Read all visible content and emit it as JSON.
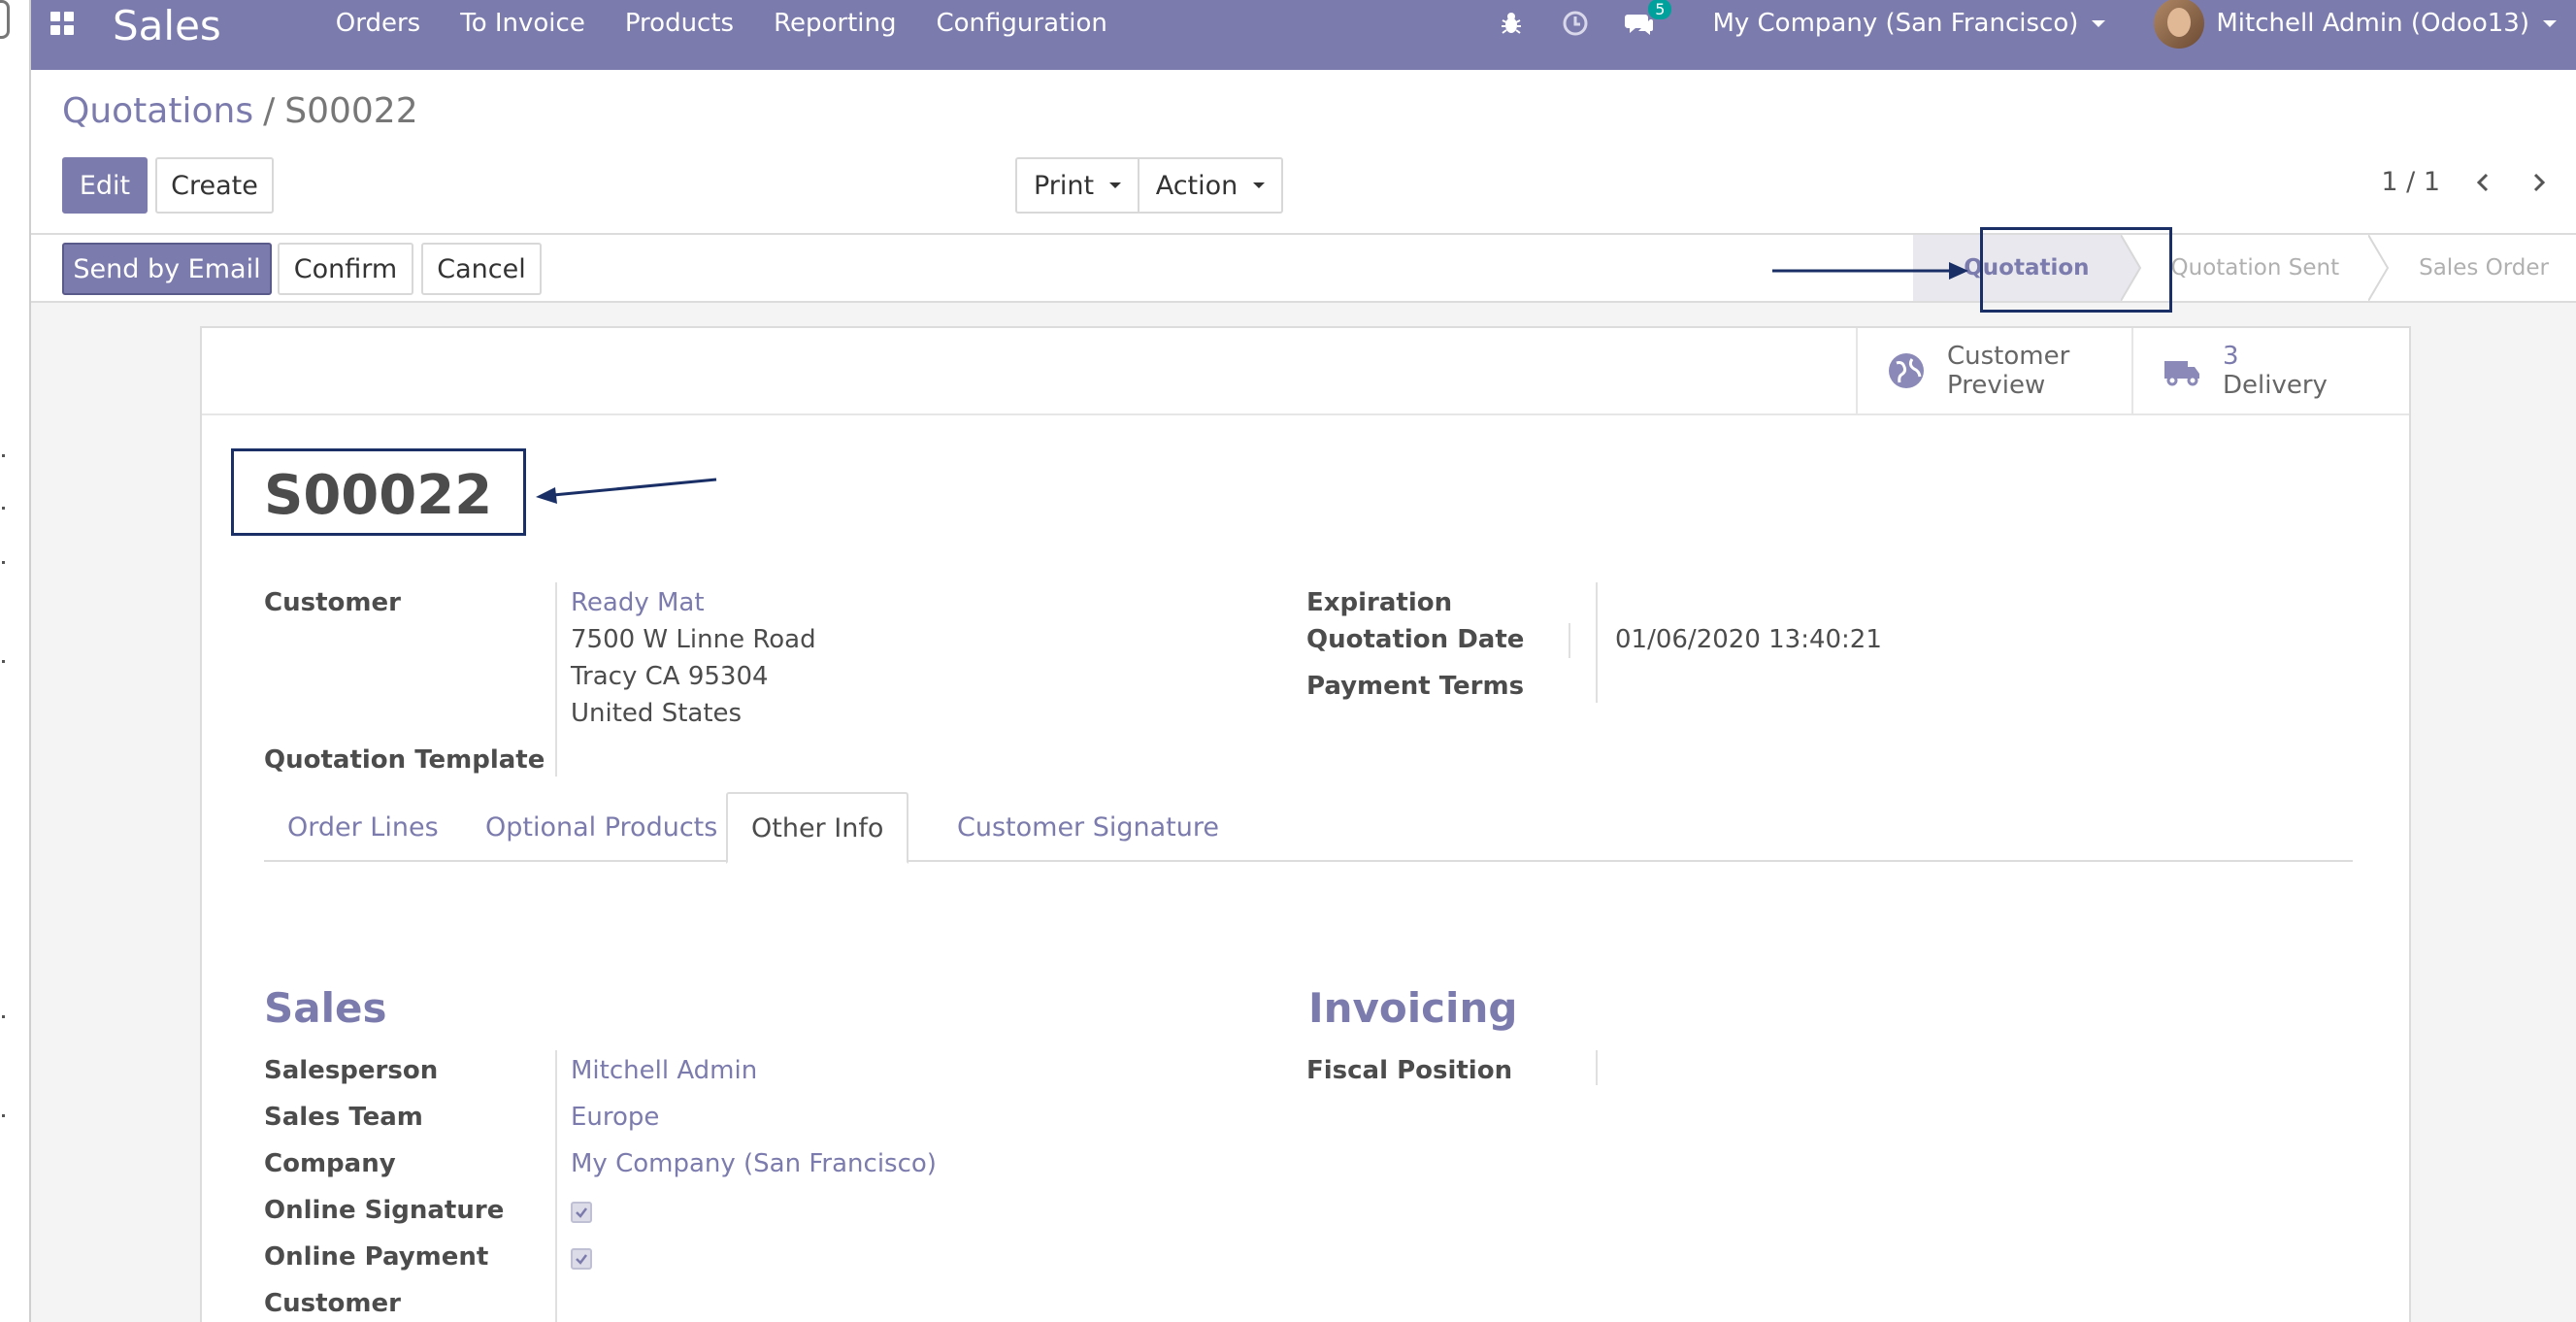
{
  "navbar": {
    "app_name": "Sales",
    "menu": [
      "Orders",
      "To Invoice",
      "Products",
      "Reporting",
      "Configuration"
    ],
    "chat_count": "5",
    "company": "My Company (San Francisco)",
    "user": "Mitchell Admin (Odoo13)"
  },
  "control": {
    "breadcrumb_parent": "Quotations",
    "breadcrumb_sep": "/",
    "breadcrumb_current": "S00022",
    "edit_label": "Edit",
    "create_label": "Create",
    "print_label": "Print",
    "action_label": "Action",
    "pager": "1 / 1"
  },
  "statusbar": {
    "send_email_label": "Send by Email",
    "confirm_label": "Confirm",
    "cancel_label": "Cancel",
    "stages": [
      "Quotation",
      "Quotation Sent",
      "Sales Order"
    ],
    "active_stage": "Quotation"
  },
  "smart_buttons": {
    "preview_line1": "Customer",
    "preview_line2": "Preview",
    "delivery_count": "3",
    "delivery_label": "Delivery"
  },
  "form": {
    "name": "S00022",
    "customer_label": "Customer",
    "customer_name": "Ready Mat",
    "customer_addr1": "7500 W Linne Road",
    "customer_addr2": "Tracy CA 95304",
    "customer_addr3": "United States",
    "template_label": "Quotation Template",
    "expiration_label": "Expiration",
    "quotation_date_label": "Quotation Date",
    "quotation_date_value": "01/06/2020 13:40:21",
    "payment_terms_label": "Payment Terms"
  },
  "tabs": [
    "Order Lines",
    "Optional Products",
    "Other Info",
    "Customer Signature"
  ],
  "active_tab": "Other Info",
  "other_info": {
    "sales_title": "Sales",
    "salesperson_label": "Salesperson",
    "salesperson_value": "Mitchell Admin",
    "sales_team_label": "Sales Team",
    "sales_team_value": "Europe",
    "company_label": "Company",
    "company_value": "My Company (San Francisco)",
    "online_signature_label": "Online Signature",
    "online_signature_checked": true,
    "online_payment_label": "Online Payment",
    "online_payment_checked": true,
    "customer_label": "Customer",
    "invoicing_title": "Invoicing",
    "fiscal_position_label": "Fiscal Position"
  },
  "colors": {
    "brand": "#7c7bad",
    "annotation": "#1a2f66",
    "badge": "#00a09d"
  }
}
